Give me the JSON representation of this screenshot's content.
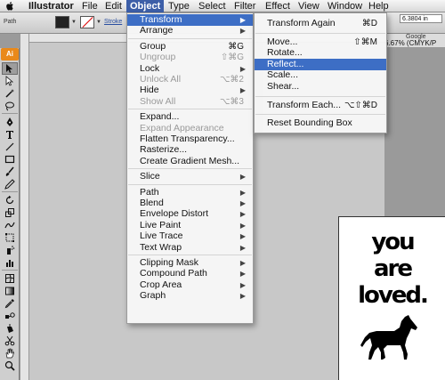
{
  "menubar": {
    "app_name": "Illustrator",
    "items": [
      "File",
      "Edit",
      "Object",
      "Type",
      "Select",
      "Filter",
      "Effect",
      "View",
      "Window",
      "Help"
    ]
  },
  "controlbar": {
    "path_label": "Path",
    "stroke_label": "Stroke",
    "x_value": "6.3804 in"
  },
  "doc_info": {
    "search_label": "Google",
    "zoom_label": "6.67% (CMYK/P"
  },
  "toolbox": {
    "badge": "Ai",
    "tools": [
      "selection-tool",
      "direct-selection-tool",
      "magic-wand-tool",
      "lasso-tool",
      "pen-tool",
      "type-tool",
      "line-tool",
      "rectangle-tool",
      "paintbrush-tool",
      "pencil-tool",
      "rotate-tool",
      "scale-tool",
      "warp-tool",
      "free-transform-tool",
      "symbol-sprayer-tool",
      "column-graph-tool",
      "mesh-tool",
      "gradient-tool",
      "eyedropper-tool",
      "blend-tool",
      "live-paint-tool",
      "scissors-tool",
      "hand-tool",
      "zoom-tool"
    ]
  },
  "object_menu": {
    "items": [
      {
        "label": "Transform",
        "submenu": true,
        "highlighted": true
      },
      {
        "label": "Arrange",
        "submenu": true
      },
      {
        "sep": true
      },
      {
        "label": "Group",
        "shortcut": "⌘G"
      },
      {
        "label": "Ungroup",
        "shortcut": "⇧⌘G",
        "disabled": true
      },
      {
        "label": "Lock",
        "submenu": true
      },
      {
        "label": "Unlock All",
        "shortcut": "⌥⌘2",
        "disabled": true
      },
      {
        "label": "Hide",
        "submenu": true
      },
      {
        "label": "Show All",
        "shortcut": "⌥⌘3",
        "disabled": true
      },
      {
        "sep": true
      },
      {
        "label": "Expand..."
      },
      {
        "label": "Expand Appearance",
        "disabled": true
      },
      {
        "label": "Flatten Transparency..."
      },
      {
        "label": "Rasterize..."
      },
      {
        "label": "Create Gradient Mesh..."
      },
      {
        "sep": true
      },
      {
        "label": "Slice",
        "submenu": true
      },
      {
        "sep": true
      },
      {
        "label": "Path",
        "submenu": true
      },
      {
        "label": "Blend",
        "submenu": true
      },
      {
        "label": "Envelope Distort",
        "submenu": true
      },
      {
        "label": "Live Paint",
        "submenu": true
      },
      {
        "label": "Live Trace",
        "submenu": true
      },
      {
        "label": "Text Wrap",
        "submenu": true
      },
      {
        "sep": true
      },
      {
        "label": "Clipping Mask",
        "submenu": true
      },
      {
        "label": "Compound Path",
        "submenu": true
      },
      {
        "label": "Crop Area",
        "submenu": true
      },
      {
        "label": "Graph",
        "submenu": true
      }
    ]
  },
  "transform_menu": {
    "items": [
      {
        "label": "Transform Again",
        "shortcut": "⌘D"
      },
      {
        "sep": true
      },
      {
        "label": "Move...",
        "shortcut": "⇧⌘M"
      },
      {
        "label": "Rotate..."
      },
      {
        "label": "Reflect...",
        "highlighted": true
      },
      {
        "label": "Scale..."
      },
      {
        "label": "Shear..."
      },
      {
        "sep": true
      },
      {
        "label": "Transform Each...",
        "shortcut": "⌥⇧⌘D"
      },
      {
        "sep": true
      },
      {
        "label": "Reset Bounding Box"
      }
    ]
  },
  "artboard": {
    "lines": [
      "you",
      "are",
      "loved."
    ],
    "graphic": "horse-icon"
  }
}
